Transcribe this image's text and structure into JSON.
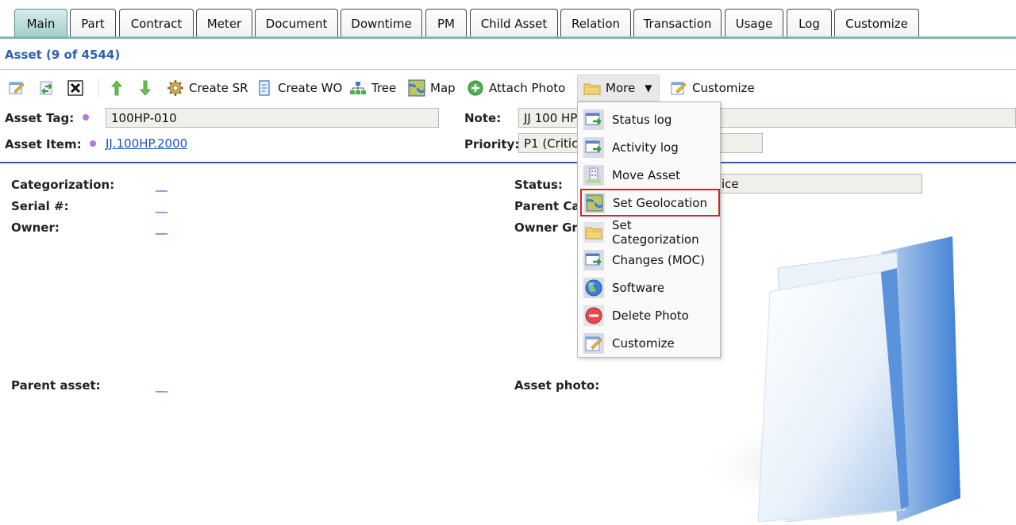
{
  "tabs": [
    {
      "label": "Main",
      "active": true
    },
    {
      "label": "Part"
    },
    {
      "label": "Contract"
    },
    {
      "label": "Meter"
    },
    {
      "label": "Document"
    },
    {
      "label": "Downtime"
    },
    {
      "label": "PM"
    },
    {
      "label": "Child Asset"
    },
    {
      "label": "Relation"
    },
    {
      "label": "Transaction"
    },
    {
      "label": "Usage"
    },
    {
      "label": "Log"
    },
    {
      "label": "Customize"
    }
  ],
  "header": {
    "title": "Asset (9 of 4544)"
  },
  "toolbar": {
    "create_sr": "Create SR",
    "create_wo": "Create WO",
    "tree": "Tree",
    "map": "Map",
    "attach_photo": "Attach Photo",
    "more": "More",
    "customize": "Customize"
  },
  "form": {
    "asset_tag_label": "Asset Tag:",
    "asset_tag_value": "100HP-010",
    "asset_item_label": "Asset Item:",
    "asset_item_value": "JJ.100HP.2000",
    "note_label": "Note:",
    "note_value": "JJ 100 HP",
    "priority_label": "Priority:",
    "priority_value": "P1 (Critica"
  },
  "details": {
    "categorization_label": "Categorization:",
    "serial_label": "Serial #:",
    "owner_label": "Owner:",
    "parent_asset_label": "Parent asset:",
    "status_label": "Status:",
    "status_value": "ice",
    "parent_cat_label": "Parent Ca",
    "owner_group_label": "Owner Gr",
    "asset_photo_label": "Asset photo:",
    "empty_link": "__"
  },
  "more_menu": {
    "items": [
      {
        "label": "Status log",
        "icon": "green-arrow-doc-icon"
      },
      {
        "label": "Activity log",
        "icon": "green-arrow-doc-icon"
      },
      {
        "label": "Move Asset",
        "icon": "move-asset-icon"
      },
      {
        "label": "Set Geolocation",
        "icon": "map-icon",
        "highlighted": true
      },
      {
        "label": "Set Categorization",
        "icon": "folder-icon"
      },
      {
        "label": "Changes (MOC)",
        "icon": "green-arrow-doc-icon"
      },
      {
        "label": "Software",
        "icon": "globe-icon"
      },
      {
        "label": "Delete Photo",
        "icon": "minus-circle-icon"
      },
      {
        "label": "Customize",
        "icon": "customize-icon"
      }
    ]
  },
  "colors": {
    "tab_accent": "#7fb8b5",
    "header_blue": "#2d5fb5",
    "link_blue": "#1e4fc4",
    "highlight_red": "#e02020"
  }
}
